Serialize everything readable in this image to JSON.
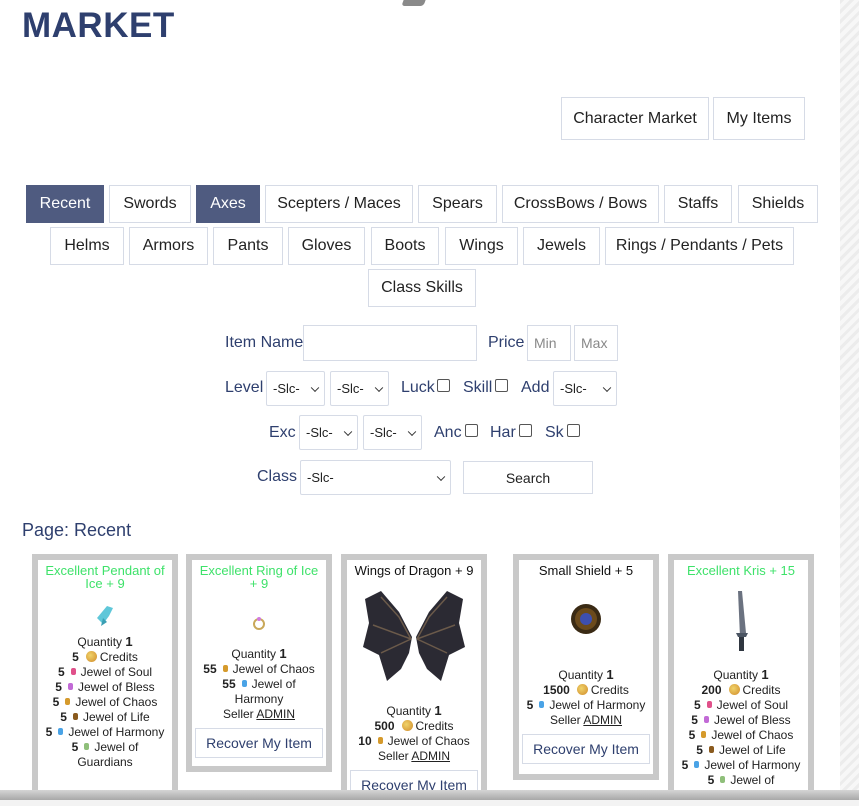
{
  "page_title": "MARKET",
  "top_buttons": [
    "Character Market",
    "My Items"
  ],
  "categories_row1": [
    "Recent",
    "Swords",
    "Axes",
    "Scepters / Maces",
    "Spears",
    "CrossBows / Bows",
    "Staffs",
    "Shields"
  ],
  "categories_row2": [
    "Helms",
    "Armors",
    "Pants",
    "Gloves",
    "Boots",
    "Wings",
    "Jewels",
    "Rings / Pendants / Pets"
  ],
  "categories_row3": [
    "Class Skills"
  ],
  "filters": {
    "item_name_label": "Item Name",
    "price_label": "Price",
    "min_placeholder": "Min",
    "max_placeholder": "Max",
    "level_label": "Level",
    "select_default": "-Slc-",
    "luck_label": "Luck",
    "skill_label": "Skill",
    "add_label": "Add",
    "exc_label": "Exc",
    "anc_label": "Anc",
    "har_label": "Har",
    "sk_label": "Sk",
    "class_label": "Class",
    "search_label": "Search"
  },
  "page_label": "Page: Recent",
  "cards": [
    {
      "name": "Excellent Pendant of Ice + 9",
      "quantity_label": "Quantity",
      "quantity": "1",
      "prices": [
        {
          "amount": "5",
          "text": "Credits"
        },
        {
          "amount": "5",
          "text": "Jewel of Soul"
        },
        {
          "amount": "5",
          "text": "Jewel of Bless"
        },
        {
          "amount": "5",
          "text": "Jewel of Chaos"
        },
        {
          "amount": "5",
          "text": "Jewel of Life"
        },
        {
          "amount": "5",
          "text": "Jewel of Harmony"
        },
        {
          "amount": "5",
          "text": "Jewel of Guardians"
        }
      ]
    },
    {
      "name": "Excellent Ring of Ice + 9",
      "quantity_label": "Quantity",
      "quantity": "1",
      "prices": [
        {
          "amount": "55",
          "text": "Jewel of Chaos"
        },
        {
          "amount": "55",
          "text": "Jewel of Harmony"
        }
      ],
      "seller_label": "Seller",
      "seller": "ADMIN",
      "action": "Recover My Item"
    },
    {
      "name": "Wings of Dragon + 9",
      "quantity_label": "Quantity",
      "quantity": "1",
      "prices": [
        {
          "amount": "500",
          "text": "Credits"
        },
        {
          "amount": "10",
          "text": "Jewel of Chaos"
        }
      ],
      "seller_label": "Seller",
      "seller": "ADMIN",
      "action": "Recover My Item"
    },
    {
      "name": "Small Shield + 5",
      "quantity_label": "Quantity",
      "quantity": "1",
      "prices": [
        {
          "amount": "1500",
          "text": "Credits"
        },
        {
          "amount": "5",
          "text": "Jewel of Harmony"
        }
      ],
      "seller_label": "Seller",
      "seller": "ADMIN",
      "action": "Recover My Item"
    },
    {
      "name": "Excellent Kris + 15",
      "quantity_label": "Quantity",
      "quantity": "1",
      "prices": [
        {
          "amount": "200",
          "text": "Credits"
        },
        {
          "amount": "5",
          "text": "Jewel of Soul"
        },
        {
          "amount": "5",
          "text": "Jewel of Bless"
        },
        {
          "amount": "5",
          "text": "Jewel of Chaos"
        },
        {
          "amount": "5",
          "text": "Jewel of Life"
        },
        {
          "amount": "5",
          "text": "Jewel of Harmony"
        },
        {
          "amount": "5",
          "text": "Jewel of"
        }
      ]
    }
  ],
  "colors": {
    "accent": "#2e3f6e",
    "active_tab": "#4f5b80",
    "excellent": "#3ee26a"
  }
}
